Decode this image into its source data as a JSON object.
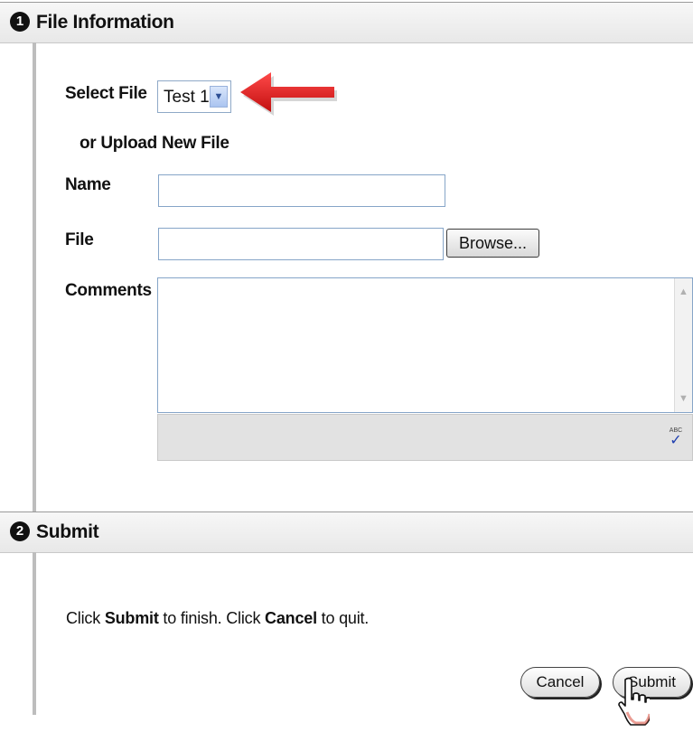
{
  "sections": [
    {
      "number": "1",
      "title": "File Information"
    },
    {
      "number": "2",
      "title": "Submit"
    }
  ],
  "file_info": {
    "select_file_label": "Select File",
    "select_file_value": "Test 1",
    "upload_label": "or Upload New File",
    "name_label": "Name",
    "name_value": "",
    "file_label": "File",
    "file_value": "",
    "browse_label": "Browse...",
    "comments_label": "Comments",
    "comments_value": ""
  },
  "submit_section": {
    "instruction_parts": [
      "Click ",
      "Submit",
      " to finish. Click ",
      "Cancel",
      " to quit."
    ],
    "cancel_label": "Cancel",
    "submit_label": "Submit"
  },
  "icons": {
    "select_arrow": "chevron-down-icon",
    "annotation_arrow": "red-arrow-icon",
    "spellcheck": "spellcheck-icon",
    "cursor": "hand-pointer-icon",
    "spellcheck_text": "ABC"
  },
  "colors": {
    "annotation_arrow": "#e01b1b",
    "input_border": "#86a5c8",
    "header_bg": "#ebebeb"
  }
}
